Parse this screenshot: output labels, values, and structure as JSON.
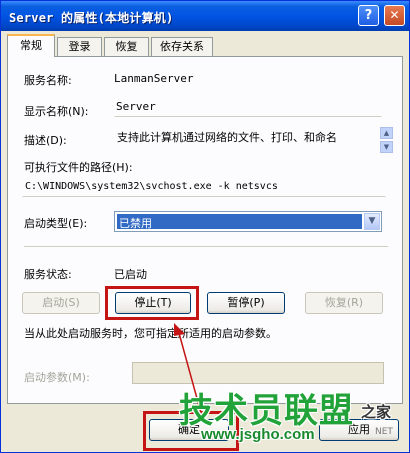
{
  "window": {
    "title": "Server 的属性(本地计算机)"
  },
  "titlebar": {
    "help_glyph": "?",
    "close_glyph": "✕"
  },
  "tabs": [
    {
      "label": "常规",
      "active": true
    },
    {
      "label": "登录"
    },
    {
      "label": "恢复"
    },
    {
      "label": "依存关系"
    }
  ],
  "general": {
    "service_name_label": "服务名称:",
    "service_name_value": "LanmanServer",
    "display_name_label": "显示名称(N):",
    "display_name_value": "Server",
    "description_label": "描述(D):",
    "description_value": "支持此计算机通过网络的文件、打印、和命名",
    "exe_path_label": "可执行文件的路径(H):",
    "exe_path_value": "C:\\WINDOWS\\system32\\svchost.exe -k netsvcs",
    "startup_type_label": "启动类型(E):",
    "startup_type_value": "已禁用",
    "status_label": "服务状态:",
    "status_value": "已启动",
    "buttons": {
      "start": "启动(S)",
      "stop": "停止(T)",
      "pause": "暂停(P)",
      "resume": "恢复(R)"
    },
    "hint_text": "当从此处启动服务时，您可指定所适用的启动参数。",
    "params_label": "启动参数(M):"
  },
  "footer": {
    "ok_label": "确定",
    "apply_label": "应用"
  },
  "watermark": {
    "brand": "技术员联盟",
    "suffix": "之家",
    "url": "www.jsgho.com",
    "net": "NET"
  },
  "colors": {
    "highlight": "#316ac5",
    "annotation_red": "#c41414",
    "watermark_green": "#22a33a"
  }
}
